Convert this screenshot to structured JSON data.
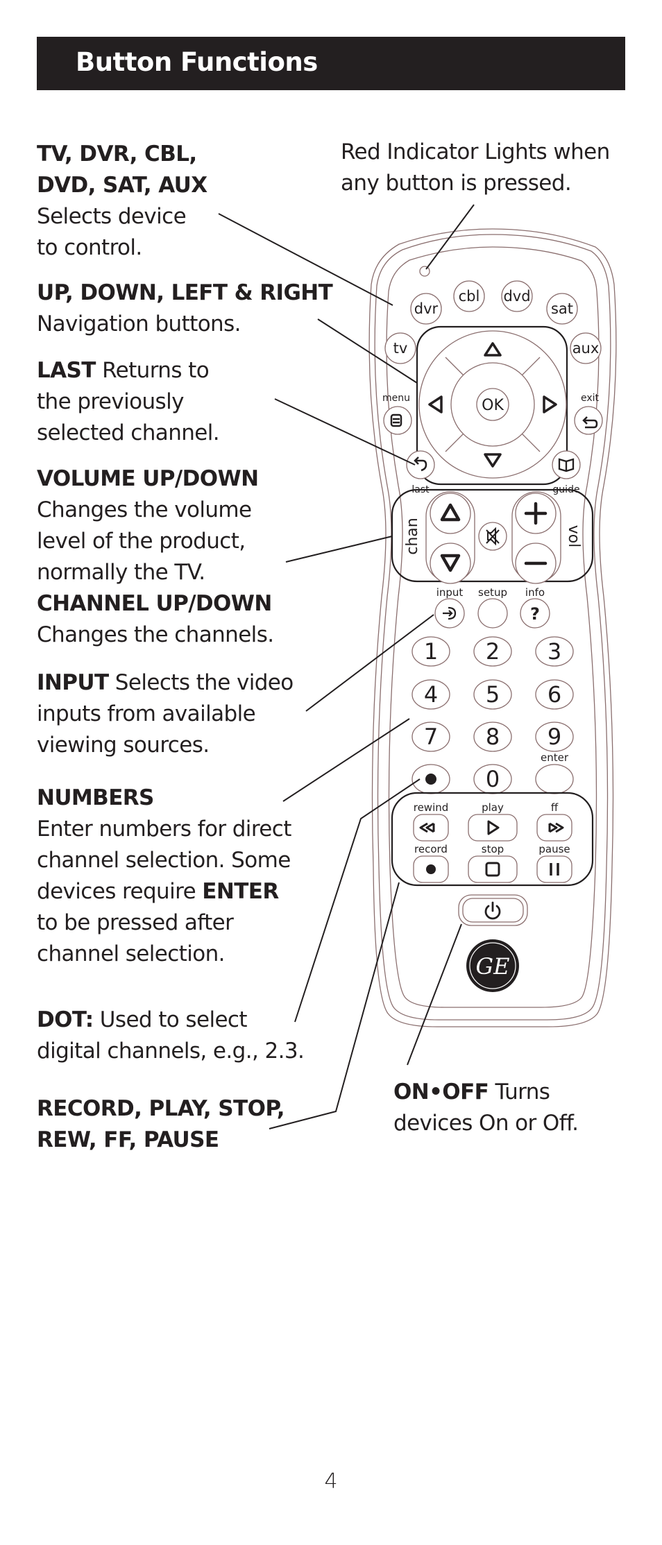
{
  "header": {
    "title": "Button Functions"
  },
  "descriptions": {
    "devices": {
      "bold_lines": [
        "TV, DVR, CBL,",
        "DVD, SAT, AUX"
      ],
      "lines": [
        "Selects device",
        "to control."
      ]
    },
    "indicator": {
      "lines": [
        "Red Indicator Lights when",
        "any button is pressed."
      ]
    },
    "navigation": {
      "bold": "UP, DOWN, LEFT & RIGHT",
      "lines": [
        "Navigation buttons."
      ]
    },
    "last": {
      "bold": "LAST",
      "first_rest": " Returns to",
      "lines": [
        "the previously",
        "selected channel."
      ]
    },
    "volume": {
      "bold": "VOLUME UP/DOWN",
      "lines": [
        "Changes the volume",
        "level of the product,",
        "normally the TV."
      ]
    },
    "channel": {
      "bold": "CHANNEL UP/DOWN",
      "lines": [
        "Changes the channels."
      ]
    },
    "input": {
      "bold": "INPUT",
      "first_rest": " Selects the video",
      "lines": [
        "inputs from available",
        "viewing sources."
      ]
    },
    "numbers": {
      "bold": "NUMBERS",
      "lines": [
        "Enter numbers for direct",
        "channel selection. Some"
      ],
      "line3_pre": "devices require ",
      "line3_bold": "ENTER",
      "lines_after": [
        "to be pressed after",
        "channel selection."
      ]
    },
    "dot": {
      "bold": "DOT:",
      "first_rest": " Used to select",
      "lines": [
        "digital channels, e.g., 2.3."
      ]
    },
    "transport": {
      "bold_lines": [
        "RECORD, PLAY, STOP,",
        "REW, FF, PAUSE"
      ]
    },
    "power": {
      "bold": "ON•OFF",
      "first_rest": " Turns",
      "lines": [
        "devices On or Off."
      ]
    }
  },
  "remote": {
    "device_buttons": [
      "dvr",
      "cbl",
      "dvd",
      "sat",
      "tv",
      "aux"
    ],
    "nav": {
      "ok": "OK",
      "menu": "menu",
      "exit": "exit",
      "last": "last",
      "guide": "guide"
    },
    "chan_label": "chan",
    "vol_label": "vol",
    "func_labels": {
      "input": "input",
      "setup": "setup",
      "info": "info",
      "info_glyph": "?"
    },
    "numbers": [
      "1",
      "2",
      "3",
      "4",
      "5",
      "6",
      "7",
      "8",
      "9",
      "",
      "0",
      ""
    ],
    "enter_label": "enter",
    "transport_labels": [
      "rewind",
      "play",
      "ff",
      "record",
      "stop",
      "pause"
    ],
    "logo": "GE",
    "outline_color": "#8a6e6e",
    "ink_color": "#231f20"
  },
  "footer": {
    "page_number": "4"
  }
}
